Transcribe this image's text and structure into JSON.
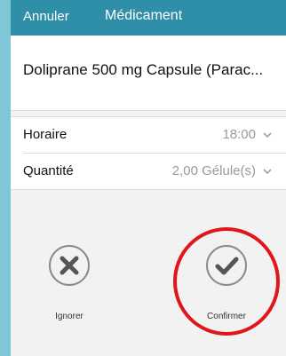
{
  "header": {
    "cancel_label": "Annuler",
    "title": "Médicament"
  },
  "medication": {
    "name": "Doliprane 500 mg Capsule (Parac..."
  },
  "fields": [
    {
      "label": "Horaire",
      "value": "18:00"
    },
    {
      "label": "Quantité",
      "value": "2,00 Gélule(s)"
    }
  ],
  "actions": {
    "ignore_label": "Ignorer",
    "confirm_label": "Confirmer"
  },
  "colors": {
    "header_bg": "#2f8ea8",
    "side_border": "#7fc6d6",
    "highlight_ring": "#e0161b",
    "icon_gray": "#555555"
  }
}
